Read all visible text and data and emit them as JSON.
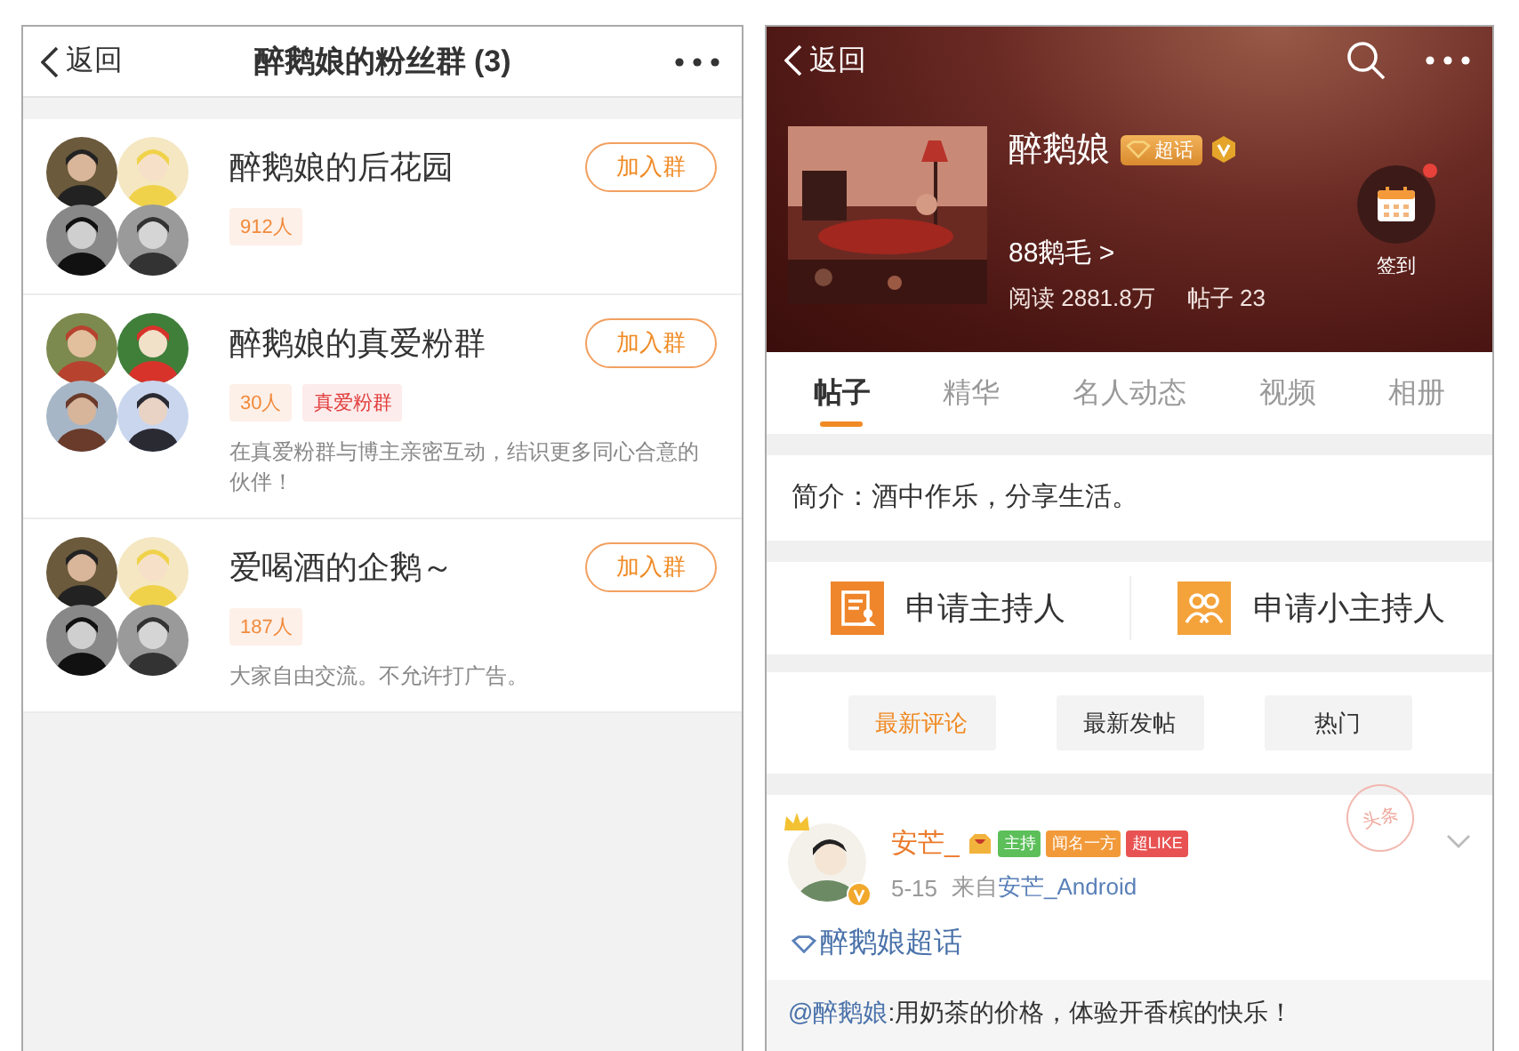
{
  "left": {
    "nav": {
      "back": "返回",
      "title": "醉鹅娘的粉丝群 (3)"
    },
    "groups": [
      {
        "name": "醉鹅娘的后花园",
        "tags": [
          {
            "text": "912人",
            "kind": "count"
          }
        ],
        "button": "加入群"
      },
      {
        "name": "醉鹅娘的真爱粉群",
        "tags": [
          {
            "text": "30人",
            "kind": "count"
          },
          {
            "text": "真爱粉群",
            "kind": "special"
          }
        ],
        "description": "在真爱粉群与博主亲密互动，结识更多同心合意的伙伴！",
        "button": "加入群"
      },
      {
        "name": "爱喝酒的企鹅～",
        "tags": [
          {
            "text": "187人",
            "kind": "count"
          }
        ],
        "description": "大家自由交流。不允许打广告。",
        "button": "加入群"
      }
    ]
  },
  "right": {
    "nav": {
      "back": "返回"
    },
    "topic": {
      "name": "醉鹅娘",
      "badge": "超话",
      "feathers": "88鹅毛 >",
      "reads": "阅读 2881.8万",
      "posts": "帖子 23",
      "checkin": {
        "label": "签到",
        "notification": true
      }
    },
    "tabs": [
      {
        "label": "帖子",
        "selected": true
      },
      {
        "label": "精华",
        "selected": false
      },
      {
        "label": "名人动态",
        "selected": false
      },
      {
        "label": "视频",
        "selected": false
      },
      {
        "label": "相册",
        "selected": false
      }
    ],
    "intro": "简介：酒中作乐，分享生活。",
    "apply_buttons": [
      {
        "label": "申请主持人",
        "kind": "host"
      },
      {
        "label": "申请小主持人",
        "kind": "subhost"
      }
    ],
    "sort": [
      {
        "label": "最新评论",
        "selected": true
      },
      {
        "label": "最新发帖",
        "selected": false
      },
      {
        "label": "热门",
        "selected": false
      }
    ],
    "post": {
      "author": "安芒_",
      "badges": [
        {
          "text": "主持",
          "kind": "host"
        },
        {
          "text": "闻名一方",
          "kind": "fame"
        },
        {
          "text": "超LIKE",
          "kind": "like"
        }
      ],
      "stamp": "头条",
      "date": "5-15",
      "source_prefix": "来自",
      "source": "安芒_Android",
      "topic_link": "醉鹅娘超话",
      "mention": "@醉鹅娘",
      "quote": ":用奶茶的价格，体验开香槟的快乐！"
    }
  }
}
